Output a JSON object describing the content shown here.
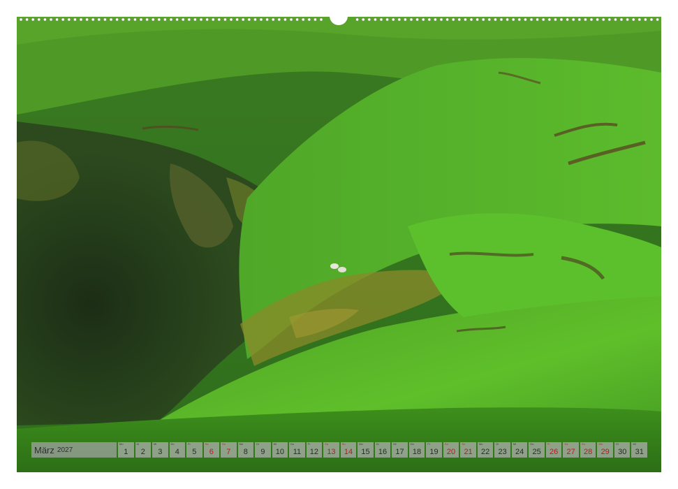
{
  "calendar": {
    "month": "März",
    "year": "2027",
    "days": [
      {
        "day": "1",
        "weekday": "Mo",
        "red": false
      },
      {
        "day": "2",
        "weekday": "Di",
        "red": false
      },
      {
        "day": "3",
        "weekday": "Mi",
        "red": false
      },
      {
        "day": "4",
        "weekday": "Do",
        "red": false
      },
      {
        "day": "5",
        "weekday": "Fr",
        "red": false
      },
      {
        "day": "6",
        "weekday": "Sa",
        "red": true
      },
      {
        "day": "7",
        "weekday": "So",
        "red": true
      },
      {
        "day": "8",
        "weekday": "Mo",
        "red": false
      },
      {
        "day": "9",
        "weekday": "Di",
        "red": false
      },
      {
        "day": "10",
        "weekday": "Mi",
        "red": false
      },
      {
        "day": "11",
        "weekday": "Do",
        "red": false
      },
      {
        "day": "12",
        "weekday": "Fr",
        "red": false
      },
      {
        "day": "13",
        "weekday": "Sa",
        "red": true
      },
      {
        "day": "14",
        "weekday": "So",
        "red": true
      },
      {
        "day": "15",
        "weekday": "Mo",
        "red": false
      },
      {
        "day": "16",
        "weekday": "Di",
        "red": false
      },
      {
        "day": "17",
        "weekday": "Mi",
        "red": false
      },
      {
        "day": "18",
        "weekday": "Do",
        "red": false
      },
      {
        "day": "19",
        "weekday": "Fr",
        "red": false
      },
      {
        "day": "20",
        "weekday": "Sa",
        "red": true
      },
      {
        "day": "21",
        "weekday": "So",
        "red": true
      },
      {
        "day": "22",
        "weekday": "Mo",
        "red": false
      },
      {
        "day": "23",
        "weekday": "Di",
        "red": false
      },
      {
        "day": "24",
        "weekday": "Mi",
        "red": false
      },
      {
        "day": "25",
        "weekday": "Do",
        "red": false
      },
      {
        "day": "26",
        "weekday": "Fr",
        "red": true
      },
      {
        "day": "27",
        "weekday": "Sa",
        "red": true
      },
      {
        "day": "28",
        "weekday": "So",
        "red": true
      },
      {
        "day": "29",
        "weekday": "Mo",
        "red": true
      },
      {
        "day": "30",
        "weekday": "Di",
        "red": false
      },
      {
        "day": "31",
        "weekday": "Mi",
        "red": false
      }
    ]
  },
  "colors": {
    "grass_light": "#5fbf2a",
    "grass_mid": "#3f9420",
    "grass_dark": "#2a6a1a",
    "gorge_shadow": "#243b1c",
    "rock_moss": "#8a8a2a",
    "holiday_red": "#c0161d"
  },
  "photo_subject": "green-hills-gorge-with-sheep"
}
